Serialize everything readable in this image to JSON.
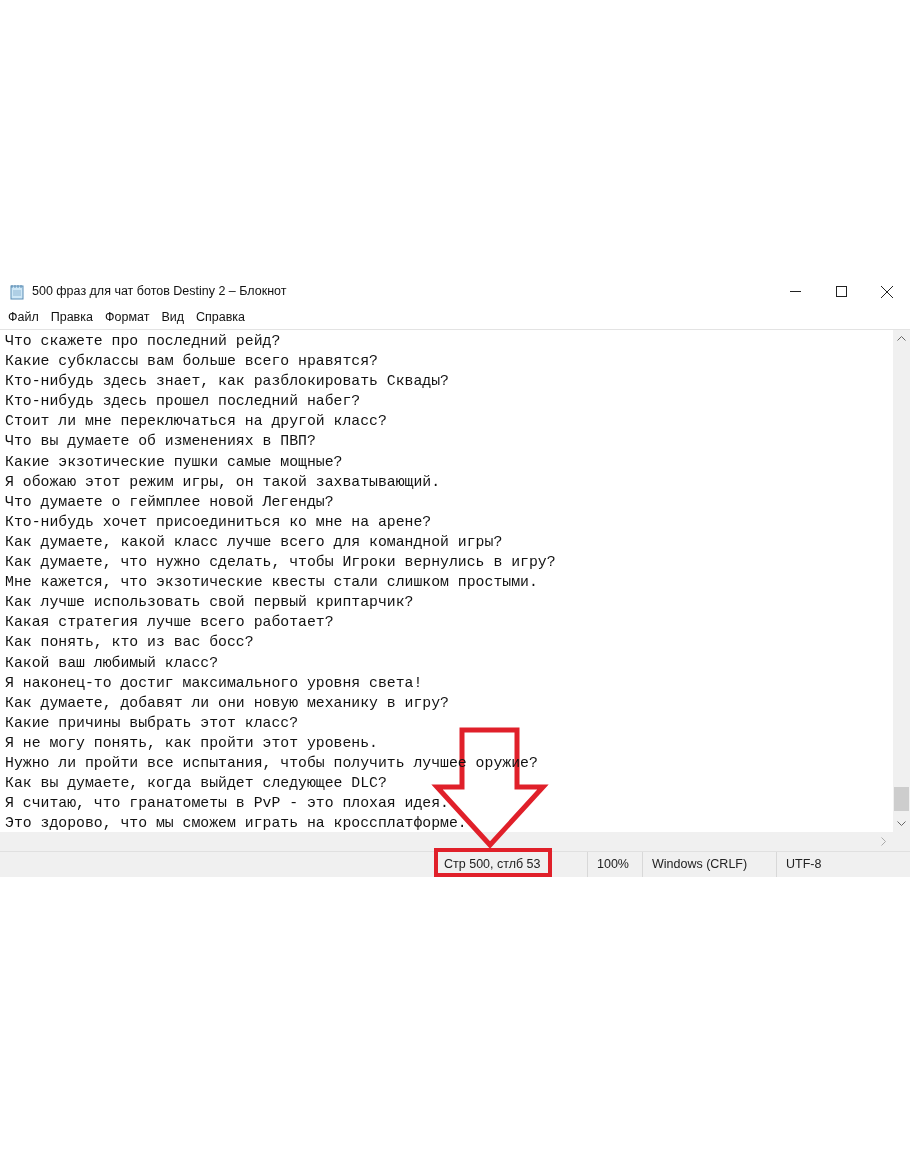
{
  "window": {
    "title": "500 фраз для чат ботов Destiny 2 – Блокнот"
  },
  "menu": [
    "Файл",
    "Правка",
    "Формат",
    "Вид",
    "Справка"
  ],
  "editor": {
    "lines": [
      "Что скажете про последний рейд?",
      "Какие субклассы вам больше всего нравятся?",
      "Кто-нибудь здесь знает, как разблокировать Сквады?",
      "Кто-нибудь здесь прошел последний набег?",
      "Стоит ли мне переключаться на другой класс?",
      "Что вы думаете об изменениях в ПВП?",
      "Какие экзотические пушки самые мощные?",
      "Я обожаю этот режим игры, он такой захватывающий.",
      "Что думаете о геймплее новой Легенды?",
      "Кто-нибудь хочет присоединиться ко мне на арене?",
      "Как думаете, какой класс лучше всего для командной игры?",
      "Как думаете, что нужно сделать, чтобы Игроки вернулись в игру?",
      "Мне кажется, что экзотические квесты стали слишком простыми.",
      "Как лучше использовать свой первый криптарчик?",
      "Какая стратегия лучше всего работает?",
      "Как понять, кто из вас босс?",
      "Какой ваш любимый класс?",
      "Я наконец-то достиг максимального уровня света!",
      "Как думаете, добавят ли они новую механику в игру?",
      "Какие причины выбрать этот класс?",
      "Я не могу понять, как пройти этот уровень.",
      "Нужно ли пройти все испытания, чтобы получить лучшее оружие?",
      "Как вы думаете, когда выйдет следующее DLC?",
      "Я считаю, что гранатометы в PvP - это плохая идея.",
      "Это здорово, что мы сможем играть на кроссплатформе."
    ]
  },
  "status_bar": {
    "position": "Стр 500, стлб 53",
    "zoom": "100%",
    "line_endings": "Windows (CRLF)",
    "encoding": "UTF-8"
  }
}
